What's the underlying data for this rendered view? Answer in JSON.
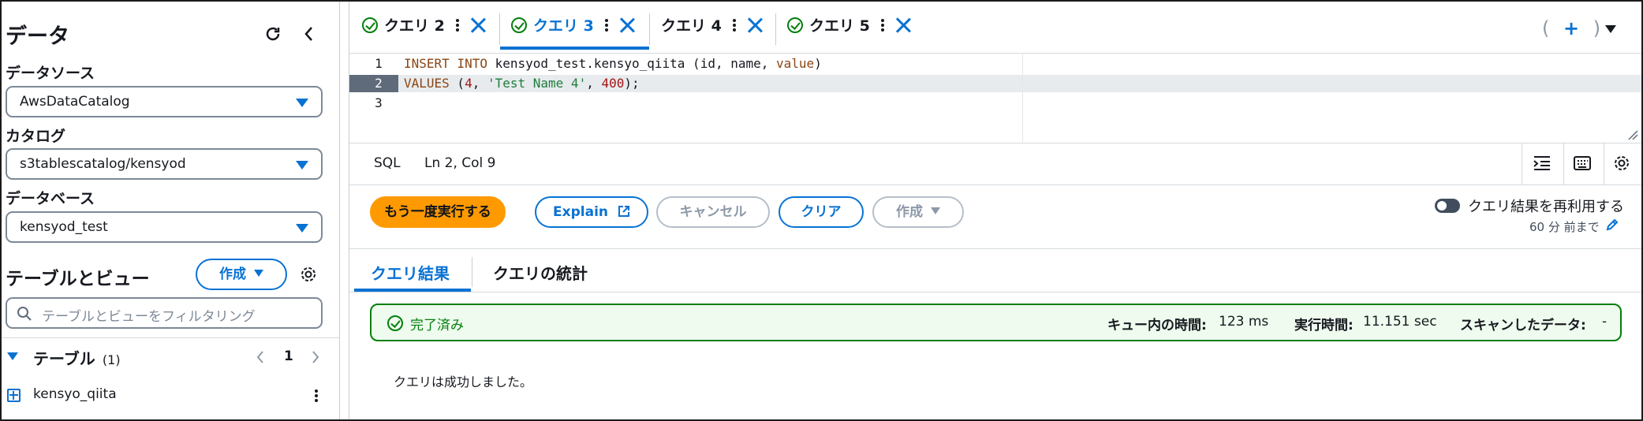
{
  "sidebar": {
    "title": "データ",
    "data_source_label": "データソース",
    "data_source_value": "AwsDataCatalog",
    "catalog_label": "カタログ",
    "catalog_value": "s3tablescatalog/kensyod",
    "database_label": "データベース",
    "database_value": "kensyod_test",
    "tables_views_label": "テーブルとビュー",
    "create_label": "作成",
    "filter_placeholder": "テーブルとビューをフィルタリング",
    "tables_header": "テーブル",
    "tables_count": "(1)",
    "page_number": "1",
    "table_items": [
      "kensyo_qiita"
    ]
  },
  "tabs": [
    {
      "label": "クエリ 2",
      "active": false
    },
    {
      "label": "クエリ 3",
      "active": true
    },
    {
      "label": "クエリ 4",
      "active": false
    },
    {
      "label": "クエリ 5",
      "active": false
    }
  ],
  "editor": {
    "line_numbers": [
      "1",
      "2",
      "3"
    ],
    "line1_kw1": "INSERT",
    "line1_kw2": "INTO",
    "line1_rest": " kensyod_test.kensyo_qiita (id, name, ",
    "line1_kw3": "value",
    "line1_end": ")",
    "line2_kw": "VALUES",
    "line2_open": " (",
    "line2_num1": "4",
    "line2_sep1": ", ",
    "line2_str": "'Test Name 4'",
    "line2_sep2": ", ",
    "line2_num2": "400",
    "line2_end": ");",
    "language": "SQL",
    "cursor_pos": "Ln 2, Col 9"
  },
  "actions": {
    "run_again": "もう一度実行する",
    "explain": "Explain",
    "cancel": "キャンセル",
    "clear": "クリア",
    "create": "作成",
    "reuse_label": "クエリ結果を再利用する",
    "reuse_time": "60 分 前まで"
  },
  "result_tabs": {
    "results": "クエリ結果",
    "stats": "クエリの統計"
  },
  "status": {
    "state": "完了済み",
    "queue_label": "キュー内の時間:",
    "queue_value": "123 ms",
    "exec_label": "実行時間:",
    "exec_value": "11.151 sec",
    "scan_label": "スキャンしたデータ:",
    "scan_value": "-"
  },
  "message": "クエリは成功しました。",
  "colors": {
    "accent": "#0972d3",
    "primary_button": "#ff9900",
    "success": "#037f0c"
  }
}
